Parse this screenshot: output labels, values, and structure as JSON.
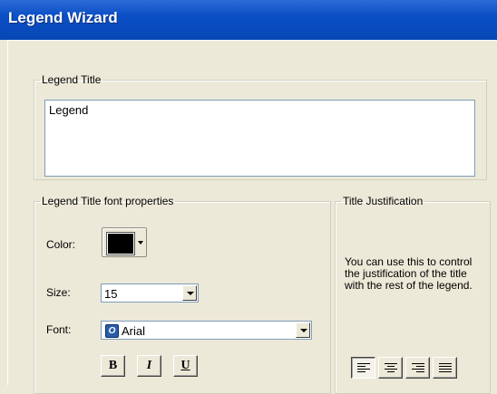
{
  "window": {
    "title": "Legend Wizard"
  },
  "legend_title_group": {
    "label": "Legend Title",
    "value": "Legend"
  },
  "font_group": {
    "label": "Legend Title font properties",
    "color_label": "Color:",
    "color_value": "#000000",
    "size_label": "Size:",
    "size_value": "15",
    "font_label": "Font:",
    "font_value": "Arial",
    "bold_label": "B",
    "italic_label": "I",
    "underline_label": "U"
  },
  "justification_group": {
    "label": "Title Justification",
    "description": "You can use this to control the justification of the title with the rest of the legend.",
    "buttons": [
      "align-left",
      "align-center",
      "align-right",
      "align-justify"
    ],
    "selected": "align-left"
  }
}
